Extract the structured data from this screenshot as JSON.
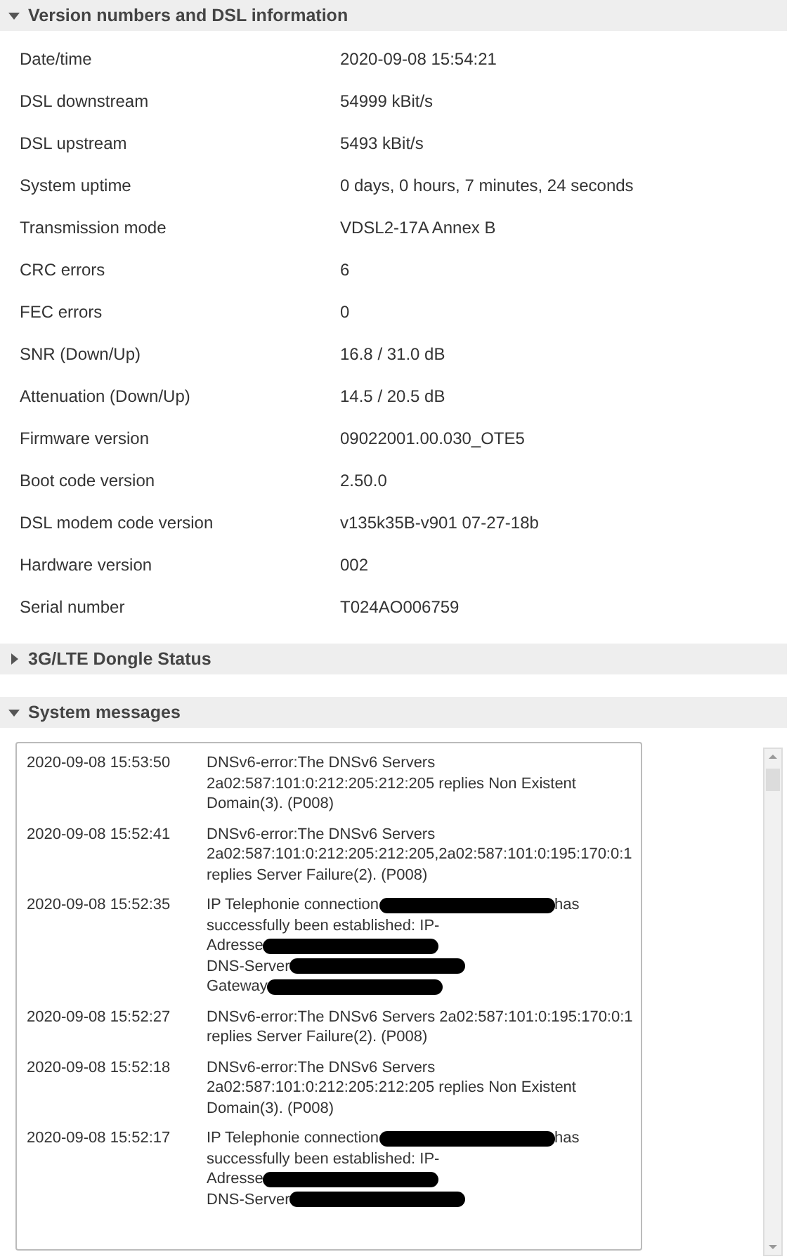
{
  "sections": [
    {
      "title": "Version numbers and DSL information",
      "expanded": true,
      "kind": "table",
      "rows": [
        {
          "label": "Date/time",
          "value": "2020-09-08 15:54:21"
        },
        {
          "label": "DSL downstream",
          "value": "54999 kBit/s"
        },
        {
          "label": "DSL upstream",
          "value": "5493 kBit/s"
        },
        {
          "label": "System uptime",
          "value": "0 days, 0 hours, 7 minutes, 24 seconds"
        },
        {
          "label": "Transmission mode",
          "value": "VDSL2-17A Annex B"
        },
        {
          "label": "CRC errors",
          "value": "6"
        },
        {
          "label": "FEC errors",
          "value": "0"
        },
        {
          "label": "SNR (Down/Up)",
          "value": "16.8 / 31.0 dB"
        },
        {
          "label": "Attenuation (Down/Up)",
          "value": "14.5 / 20.5 dB"
        },
        {
          "label": "Firmware version",
          "value": "09022001.00.030_OTE5"
        },
        {
          "label": "Boot code version",
          "value": "2.50.0"
        },
        {
          "label": "DSL modem code version",
          "value": "v135k35B-v901 07-27-18b"
        },
        {
          "label": "Hardware version",
          "value": "002"
        },
        {
          "label": "Serial number",
          "value": "T024AO006759"
        }
      ]
    },
    {
      "title": "3G/LTE Dongle Status",
      "expanded": false
    },
    {
      "title": "System messages",
      "expanded": true,
      "kind": "log",
      "messages": [
        {
          "time": "2020-09-08 15:53:50",
          "lines": [
            [
              {
                "kind": "text",
                "text": "DNSv6-error:The DNSv6 Servers 2a02:587:101:0:212:205:212:205 replies Non Existent Domain(3). (P008)"
              }
            ]
          ]
        },
        {
          "time": "2020-09-08 15:52:41",
          "lines": [
            [
              {
                "kind": "text",
                "text": "DNSv6-error:The DNSv6 Servers"
              }
            ],
            [
              {
                "kind": "text",
                "text": "2a02:587:101:0:212:205:212:205,2a02:587:101:0:195:170:0:1"
              }
            ],
            [
              {
                "kind": "text",
                "text": "replies Server Failure(2). (P008)"
              }
            ]
          ]
        },
        {
          "time": "2020-09-08 15:52:35",
          "lines": [
            [
              {
                "kind": "text",
                "text": "IP Telephonie connection"
              },
              {
                "kind": "redacted"
              },
              {
                "kind": "text",
                "text": "has"
              }
            ],
            [
              {
                "kind": "text",
                "text": "successfully been established: IP-"
              }
            ],
            [
              {
                "kind": "text",
                "text": "Adresse"
              },
              {
                "kind": "redacted"
              }
            ],
            [
              {
                "kind": "text",
                "text": "DNS-Server"
              },
              {
                "kind": "redacted"
              }
            ],
            [
              {
                "kind": "text",
                "text": "Gateway"
              },
              {
                "kind": "redacted"
              }
            ]
          ]
        },
        {
          "time": "2020-09-08 15:52:27",
          "lines": [
            [
              {
                "kind": "text",
                "text": "DNSv6-error:The DNSv6 Servers 2a02:587:101:0:195:170:0:1 replies Server Failure(2). (P008)"
              }
            ]
          ]
        },
        {
          "time": "2020-09-08 15:52:18",
          "lines": [
            [
              {
                "kind": "text",
                "text": "DNSv6-error:The DNSv6 Servers 2a02:587:101:0:212:205:212:205 replies Non Existent Domain(3). (P008)"
              }
            ]
          ]
        },
        {
          "time": "2020-09-08 15:52:17",
          "lines": [
            [
              {
                "kind": "text",
                "text": "IP Telephonie connection"
              },
              {
                "kind": "redacted"
              },
              {
                "kind": "text",
                "text": "has"
              }
            ],
            [
              {
                "kind": "text",
                "text": "successfully been established: IP-"
              }
            ],
            [
              {
                "kind": "text",
                "text": "Adresse"
              },
              {
                "kind": "redacted"
              }
            ],
            [
              {
                "kind": "text",
                "text": "DNS-Server"
              },
              {
                "kind": "redacted"
              }
            ]
          ]
        }
      ]
    }
  ]
}
